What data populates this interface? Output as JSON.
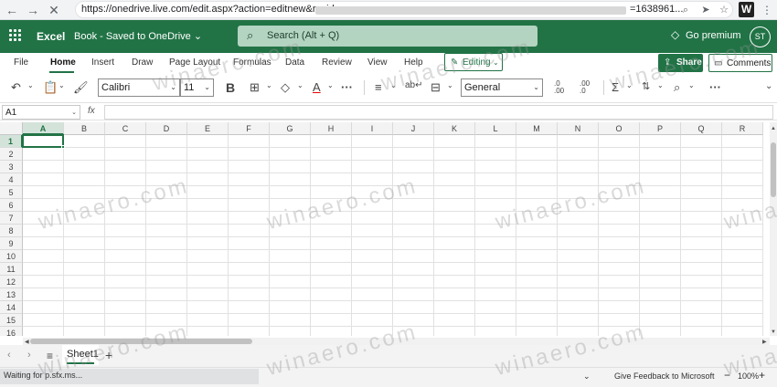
{
  "browser": {
    "url_prefix": "https://onedrive.live.com/edit.aspx?action=editnew&resid=",
    "url_suffix": "=1638961..."
  },
  "header": {
    "app_name": "Excel",
    "book_name": "Book - Saved to OneDrive ⌄",
    "search_placeholder": "Search (Alt + Q)",
    "premium_label": "Go premium",
    "avatar_initials": "ST"
  },
  "tabs": [
    {
      "label": "File"
    },
    {
      "label": "Home"
    },
    {
      "label": "Insert"
    },
    {
      "label": "Draw"
    },
    {
      "label": "Page Layout"
    },
    {
      "label": "Formulas"
    },
    {
      "label": "Data"
    },
    {
      "label": "Review"
    },
    {
      "label": "View"
    },
    {
      "label": "Help"
    }
  ],
  "actions": {
    "editing_label": "Editing",
    "share_label": "Share",
    "comments_label": "Comments"
  },
  "ribbon": {
    "font_name": "Calibri",
    "font_size": "11",
    "number_format": "General",
    "bold_label": "B"
  },
  "formula_bar": {
    "name_box": "A1",
    "fx_label": "fx",
    "formula": ""
  },
  "grid": {
    "columns": [
      "A",
      "B",
      "C",
      "D",
      "E",
      "F",
      "G",
      "H",
      "I",
      "J",
      "K",
      "L",
      "M",
      "N",
      "O",
      "P",
      "Q",
      "R"
    ],
    "rows": [
      "1",
      "2",
      "3",
      "4",
      "5",
      "6",
      "7",
      "8",
      "9",
      "10",
      "11",
      "12",
      "13",
      "14",
      "15",
      "16"
    ],
    "selected_cell": "A1"
  },
  "sheets": [
    {
      "label": "Sheet1"
    }
  ],
  "status": {
    "loading_text": "Waiting for p.sfx.ms...",
    "feedback_label": "Give Feedback to Microsoft",
    "zoom_level": "100%"
  },
  "watermark": "winaero.com",
  "colors": {
    "brand": "#217346"
  }
}
